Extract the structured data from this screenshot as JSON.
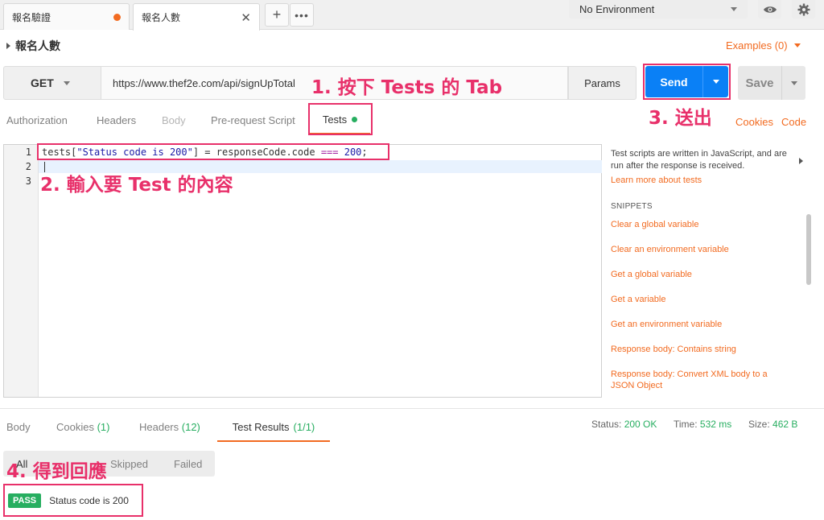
{
  "tabs": [
    {
      "label": "報名驗證",
      "unsaved": true
    },
    {
      "label": "報名人數",
      "active": true
    }
  ],
  "environment": {
    "selected": "No Environment"
  },
  "request": {
    "name": "報名人數",
    "examples_label": "Examples (0)",
    "method": "GET",
    "url": "https://www.thef2e.com/api/signUpTotal",
    "params_label": "Params",
    "send_label": "Send",
    "save_label": "Save"
  },
  "request_tabs": {
    "authorization": "Authorization",
    "headers": "Headers",
    "body": "Body",
    "prerequest": "Pre-request Script",
    "tests": "Tests",
    "cookies": "Cookies",
    "code": "Code"
  },
  "editor": {
    "line_numbers": [
      "1",
      "2",
      "3"
    ],
    "code": {
      "obj": "tests[",
      "str": "\"Status code is 200\"",
      "mid": "] = responseCode.code ",
      "op": "===",
      "num": "200",
      "end": ";"
    }
  },
  "snippets": {
    "description": "Test scripts are written in JavaScript, and are run after the response is received.",
    "learn_more": "Learn more about tests",
    "title": "SNIPPETS",
    "items": [
      "Clear a global variable",
      "Clear an environment variable",
      "Get a global variable",
      "Get a variable",
      "Get an environment variable",
      "Response body: Contains string",
      "Response body: Convert XML body to a JSON Object"
    ]
  },
  "response": {
    "tabs": {
      "body": "Body",
      "cookies": "Cookies",
      "cookies_count": "(1)",
      "headers": "Headers",
      "headers_count": "(12)",
      "results": "Test Results",
      "results_count": "(1/1)"
    },
    "status_label": "Status:",
    "status_value": "200 OK",
    "time_label": "Time:",
    "time_value": "532 ms",
    "size_label": "Size:",
    "size_value": "462 B",
    "filters": {
      "all": "All",
      "skipped": "Skipped",
      "failed": "Failed"
    },
    "result": {
      "badge": "PASS",
      "text": "Status code is 200"
    }
  },
  "annotations": {
    "step1": "1. 按下 Tests 的 Tab",
    "step2": "2. 輸入要 Test 的內容",
    "step3": "3. 送出",
    "step4": "4. 得到回應"
  },
  "colors": {
    "accent": "#f26b21",
    "send": "#0a80f6",
    "pass": "#27ae60",
    "annotation": "#e8306a"
  }
}
